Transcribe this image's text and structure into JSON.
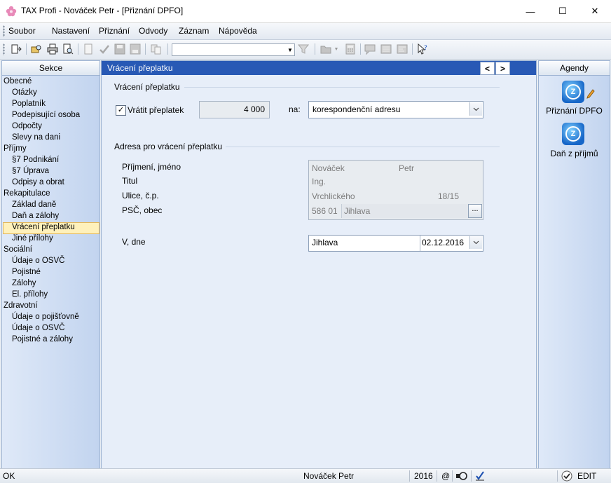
{
  "window": {
    "title": "TAX Profi - Nováček Petr - [Přiznání DPFO]",
    "minimize": "—",
    "maximize": "☐",
    "close": "✕"
  },
  "menu": [
    "Soubor",
    "Nastavení",
    "Přiznání",
    "Odvody",
    "Záznam",
    "Nápověda"
  ],
  "toolbar": {
    "combo_value": ""
  },
  "left_panel": {
    "header": "Sekce",
    "items": [
      {
        "label": "Obecné",
        "level": 0
      },
      {
        "label": "Otázky",
        "level": 1
      },
      {
        "label": "Poplatník",
        "level": 1
      },
      {
        "label": "Podepisující osoba",
        "level": 1
      },
      {
        "label": "Odpočty",
        "level": 1
      },
      {
        "label": "Slevy na dani",
        "level": 1
      },
      {
        "label": "Příjmy",
        "level": 0
      },
      {
        "label": "§7 Podnikání",
        "level": 1
      },
      {
        "label": "§7 Úprava",
        "level": 1
      },
      {
        "label": "Odpisy a obrat",
        "level": 1
      },
      {
        "label": "Rekapitulace",
        "level": 0
      },
      {
        "label": "Základ daně",
        "level": 1
      },
      {
        "label": "Daň a zálohy",
        "level": 1
      },
      {
        "label": "Vrácení přeplatku",
        "level": 1,
        "selected": true
      },
      {
        "label": "Jiné přílohy",
        "level": 1
      },
      {
        "label": "Sociální",
        "level": 0
      },
      {
        "label": "Údaje o OSVČ",
        "level": 1
      },
      {
        "label": "Pojistné",
        "level": 1
      },
      {
        "label": "Zálohy",
        "level": 1
      },
      {
        "label": "El. přílohy",
        "level": 1
      },
      {
        "label": "Zdravotní",
        "level": 0
      },
      {
        "label": "Údaje o pojišťovně",
        "level": 1
      },
      {
        "label": "Údaje o OSVČ",
        "level": 1
      },
      {
        "label": "Pojistné a zálohy",
        "level": 1
      }
    ]
  },
  "center": {
    "title": "Vrácení přeplatku",
    "prev": "<",
    "next": ">",
    "group1": {
      "title": "Vrácení přeplatku",
      "checkbox_label": "Vrátit přeplatek",
      "checkbox_checked": true,
      "amount": "4 000",
      "na_label": "na:",
      "na_value": "korespondenční adresu"
    },
    "group2": {
      "title": "Adresa pro vrácení přeplatku",
      "surname_label": "Příjmení, jméno",
      "surname": "Nováček",
      "firstname": "Petr",
      "titul_label": "Titul",
      "titul": "Ing.",
      "street_label": "Ulice, č.p.",
      "street": "Vrchlického",
      "house_no": "18/15",
      "psc_label": "PSČ, obec",
      "psc": "586 01",
      "city": "Jihlava",
      "browse": "...",
      "place_label": "V, dne",
      "place": "Jihlava",
      "date": "02.12.2016"
    }
  },
  "right_panel": {
    "header": "Agendy",
    "items": [
      "Přiznání DPFO",
      "Daň z příjmů"
    ]
  },
  "statusbar": {
    "status": "OK",
    "user": "Nováček Petr",
    "year": "2016",
    "at": "@",
    "mode": "EDIT"
  },
  "colors": {
    "accent": "#2859b5",
    "selection": "#fff1bb",
    "panel_bg": "#c2d4ef"
  }
}
